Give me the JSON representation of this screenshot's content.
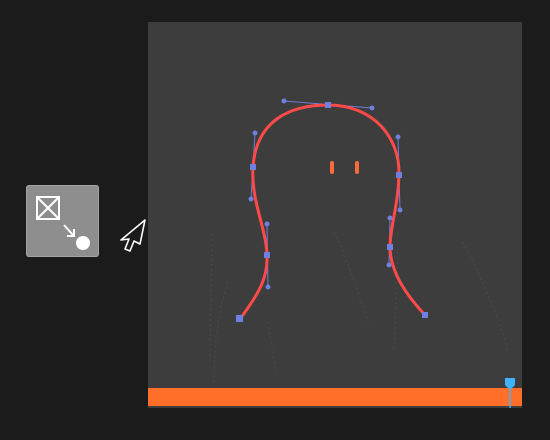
{
  "colors": {
    "background": "#1b1b1b",
    "canvas": "#3d3d3d",
    "curve": "#ff4a4a",
    "anchor": "#7080e0",
    "eyes": "#ff6a3a",
    "timeline": "#ff6f2a",
    "playhead": "#3fb3ff",
    "tool_tile": "#8e8e8e"
  },
  "toolbar": {
    "tool_icon": "frame-to-point-icon",
    "cursor_icon": "pointer-cursor-icon"
  },
  "canvas": {
    "shape": "bezier-ghost-outline",
    "anchors_visible": true,
    "handles_visible": true
  },
  "timeline": {
    "playhead_icon": "playhead-marker-icon"
  }
}
